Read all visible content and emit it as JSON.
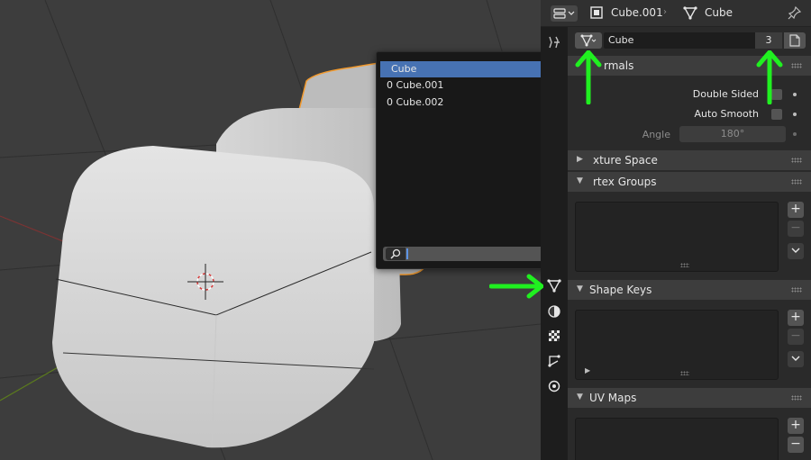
{
  "header": {
    "object_name": "Cube.001",
    "separator": "›",
    "mesh_name": "Cube",
    "pin_icon": "pin-icon"
  },
  "datablock": {
    "name": "Cube",
    "users": "3",
    "type_icon": "mesh-data-icon",
    "fake_user_icon": "fake-user-icon"
  },
  "sections": {
    "normals": {
      "title": "Normals",
      "visible_title": "rmals"
    },
    "texture_space": {
      "title": "Texture Space",
      "visible_title": "xture Space"
    },
    "vertex_groups": {
      "title": "Vertex Groups",
      "visible_title": "rtex Groups"
    },
    "shape_keys": {
      "title": "Shape Keys"
    },
    "uv_maps": {
      "title": "UV Maps"
    }
  },
  "normals": {
    "double_sided_label": "Double Sided",
    "auto_smooth_label": "Auto Smooth",
    "angle_label": "Angle",
    "angle_value": "180°"
  },
  "list_buttons": {
    "add": "+",
    "remove": "−",
    "more": "⌄"
  },
  "popup": {
    "items": [
      "Cube",
      "0 Cube.001",
      "0 Cube.002"
    ],
    "search_value": ""
  },
  "tabs": [
    "tool",
    "render",
    "output",
    "view-layer",
    "scene",
    "world",
    "object",
    "modifiers",
    "particles",
    "physics",
    "constraints",
    "data",
    "material",
    "texture",
    "object-data-nodes",
    "shading-extra"
  ],
  "colors": {
    "accent": "#4772b3",
    "arrow": "#20f020",
    "selection_outline": "#f29a2e"
  }
}
